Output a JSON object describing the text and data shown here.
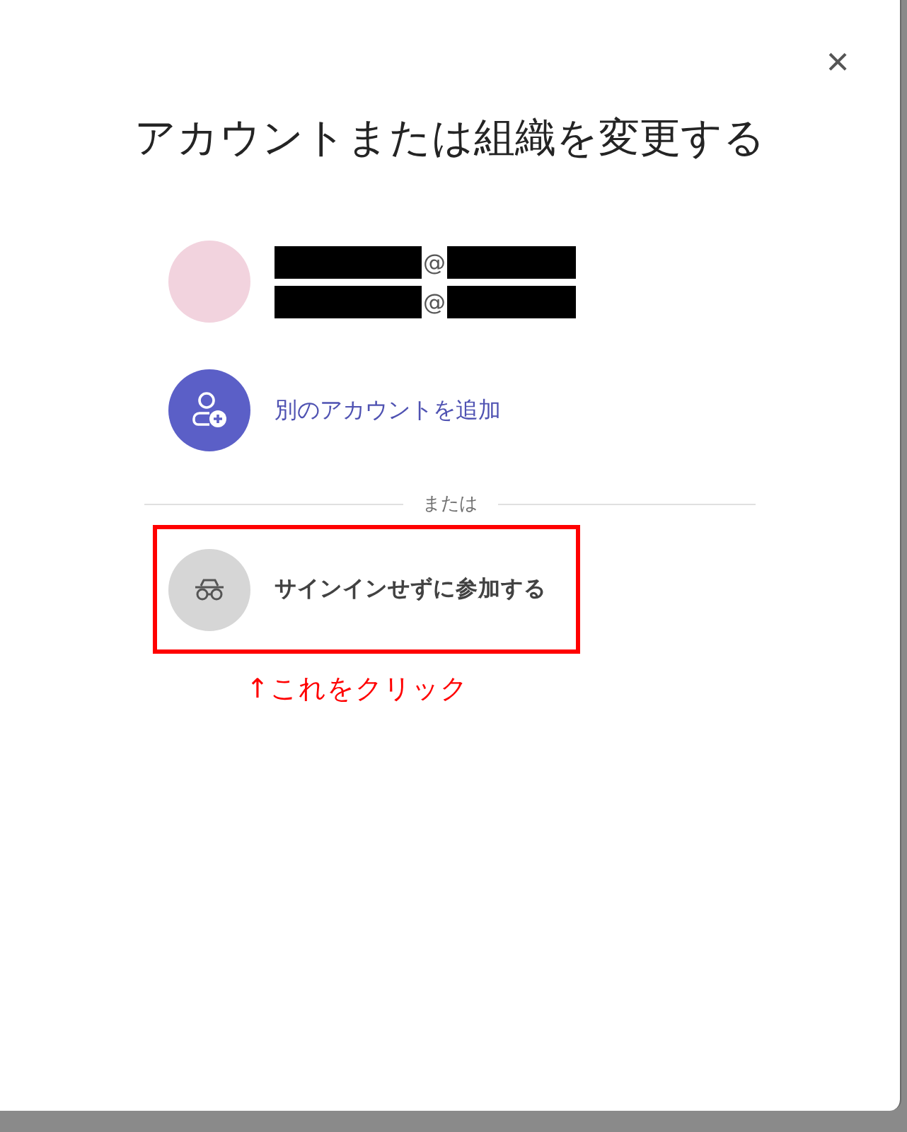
{
  "dialog": {
    "title": "アカウントまたは組織を変更する",
    "close": "×"
  },
  "account": {
    "email_lines": [
      {
        "separator": "@"
      },
      {
        "separator": "@"
      }
    ]
  },
  "add_account": {
    "label": "別のアカウントを追加"
  },
  "divider": {
    "label": "または"
  },
  "guest_option": {
    "label": "サインインせずに参加する",
    "highlighted": true
  },
  "annotation": {
    "text": "↑これをクリック"
  }
}
